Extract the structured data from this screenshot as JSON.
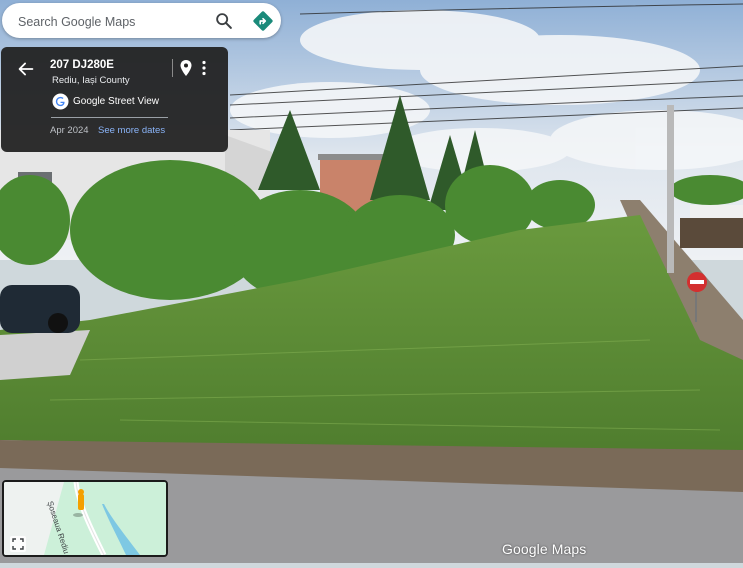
{
  "search": {
    "placeholder": "Search Google Maps"
  },
  "icons": {
    "search": "search-icon",
    "directions": "directions-icon",
    "back": "arrow-back-icon",
    "pin": "map-pin-icon",
    "more": "more-vert-icon",
    "google": "google-logo-icon",
    "expand": "fullscreen-icon"
  },
  "info_card": {
    "address": "207 DJ280E",
    "locality": "Rediu, Iași County",
    "source": "Google Street View",
    "date": "Apr 2024",
    "see_more": "See more dates"
  },
  "minimap": {
    "street": "Șoseaua Rediu"
  },
  "branding": {
    "logo": "Google Maps"
  },
  "colors": {
    "card_bg": "#212121",
    "link": "#8ab4f8",
    "directions": "#1a8a7a",
    "map_land": "#ccf0d9",
    "map_water": "#7ec8e3"
  }
}
